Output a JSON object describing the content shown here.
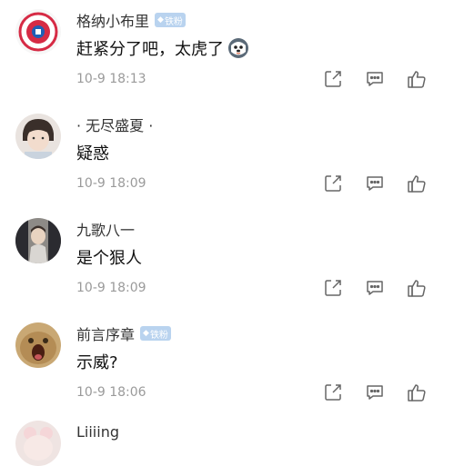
{
  "comments": [
    {
      "username": "格纳小布里",
      "badge": "铁粉",
      "content": "赶紧分了吧，太虎了",
      "emoji": "husky-face",
      "time": "10-9 18:13"
    },
    {
      "username": "· 无尽盛夏 ·",
      "badge": "",
      "content": "疑惑",
      "time": "10-9 18:09"
    },
    {
      "username": "九歌八一",
      "badge": "",
      "content": "是个狠人",
      "time": "10-9 18:09"
    },
    {
      "username": "前言序章",
      "badge": "铁粉",
      "content": "示威?",
      "time": "10-9 18:06"
    },
    {
      "username": "Liiiing",
      "badge": "",
      "content": "",
      "time": ""
    }
  ],
  "icons": {
    "share": "share-icon",
    "comment": "comment-icon",
    "like": "like-icon"
  },
  "colors": {
    "badge": "#b9d3ef",
    "timestamp": "#9a9a9a"
  }
}
